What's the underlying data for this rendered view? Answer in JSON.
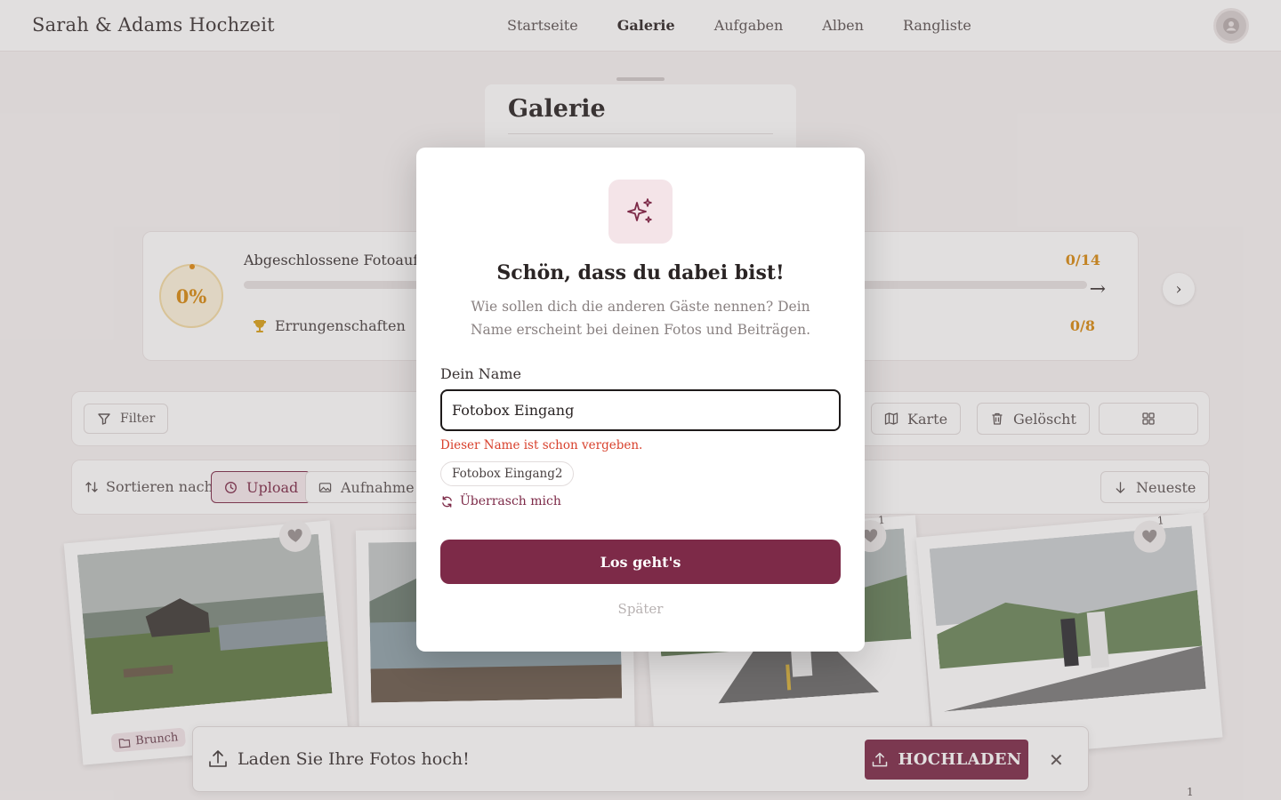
{
  "header": {
    "brand": "Sarah & Adams Hochzeit",
    "nav": [
      "Startseite",
      "Galerie",
      "Aufgaben",
      "Alben",
      "Rangliste"
    ],
    "active_nav": "Galerie"
  },
  "gallery": {
    "title": "Galerie"
  },
  "progress": {
    "percent_label": "0%",
    "tasks_title": "Abgeschlossene Fotoaufgal",
    "tasks_count": "0/14",
    "achievements_label": "Errungenschaften",
    "achievements_count": "0/8"
  },
  "toolbar": {
    "filter": "Filter",
    "map": "Karte",
    "deleted": "Gelöscht"
  },
  "sort": {
    "label": "Sortieren nach",
    "upload": "Upload",
    "capture": "Aufnahme",
    "order": "Neueste"
  },
  "photos": {
    "album_tag": "Brunch",
    "like_counts": [
      "1",
      "1",
      "1"
    ]
  },
  "upload_banner": {
    "text": "Laden Sie Ihre Fotos hoch!",
    "button": "HOCHLADEN"
  },
  "modal": {
    "title": "Schön, dass du dabei bist!",
    "subtitle": "Wie sollen dich die anderen Gäste nennen? Dein Name erscheint bei deinen Fotos und Beiträgen.",
    "name_label": "Dein Name",
    "name_value": "Fotobox Eingang",
    "error": "Dieser Name ist schon vergeben.",
    "suggestion": "Fotobox Eingang2",
    "surprise": "Überrasch mich",
    "primary_button": "Los geht's",
    "later": "Später"
  },
  "colors": {
    "primary": "#7d2a48",
    "accent_gold": "#d88a10",
    "error": "#d8402c",
    "icon_bg": "#f4e4e8"
  }
}
